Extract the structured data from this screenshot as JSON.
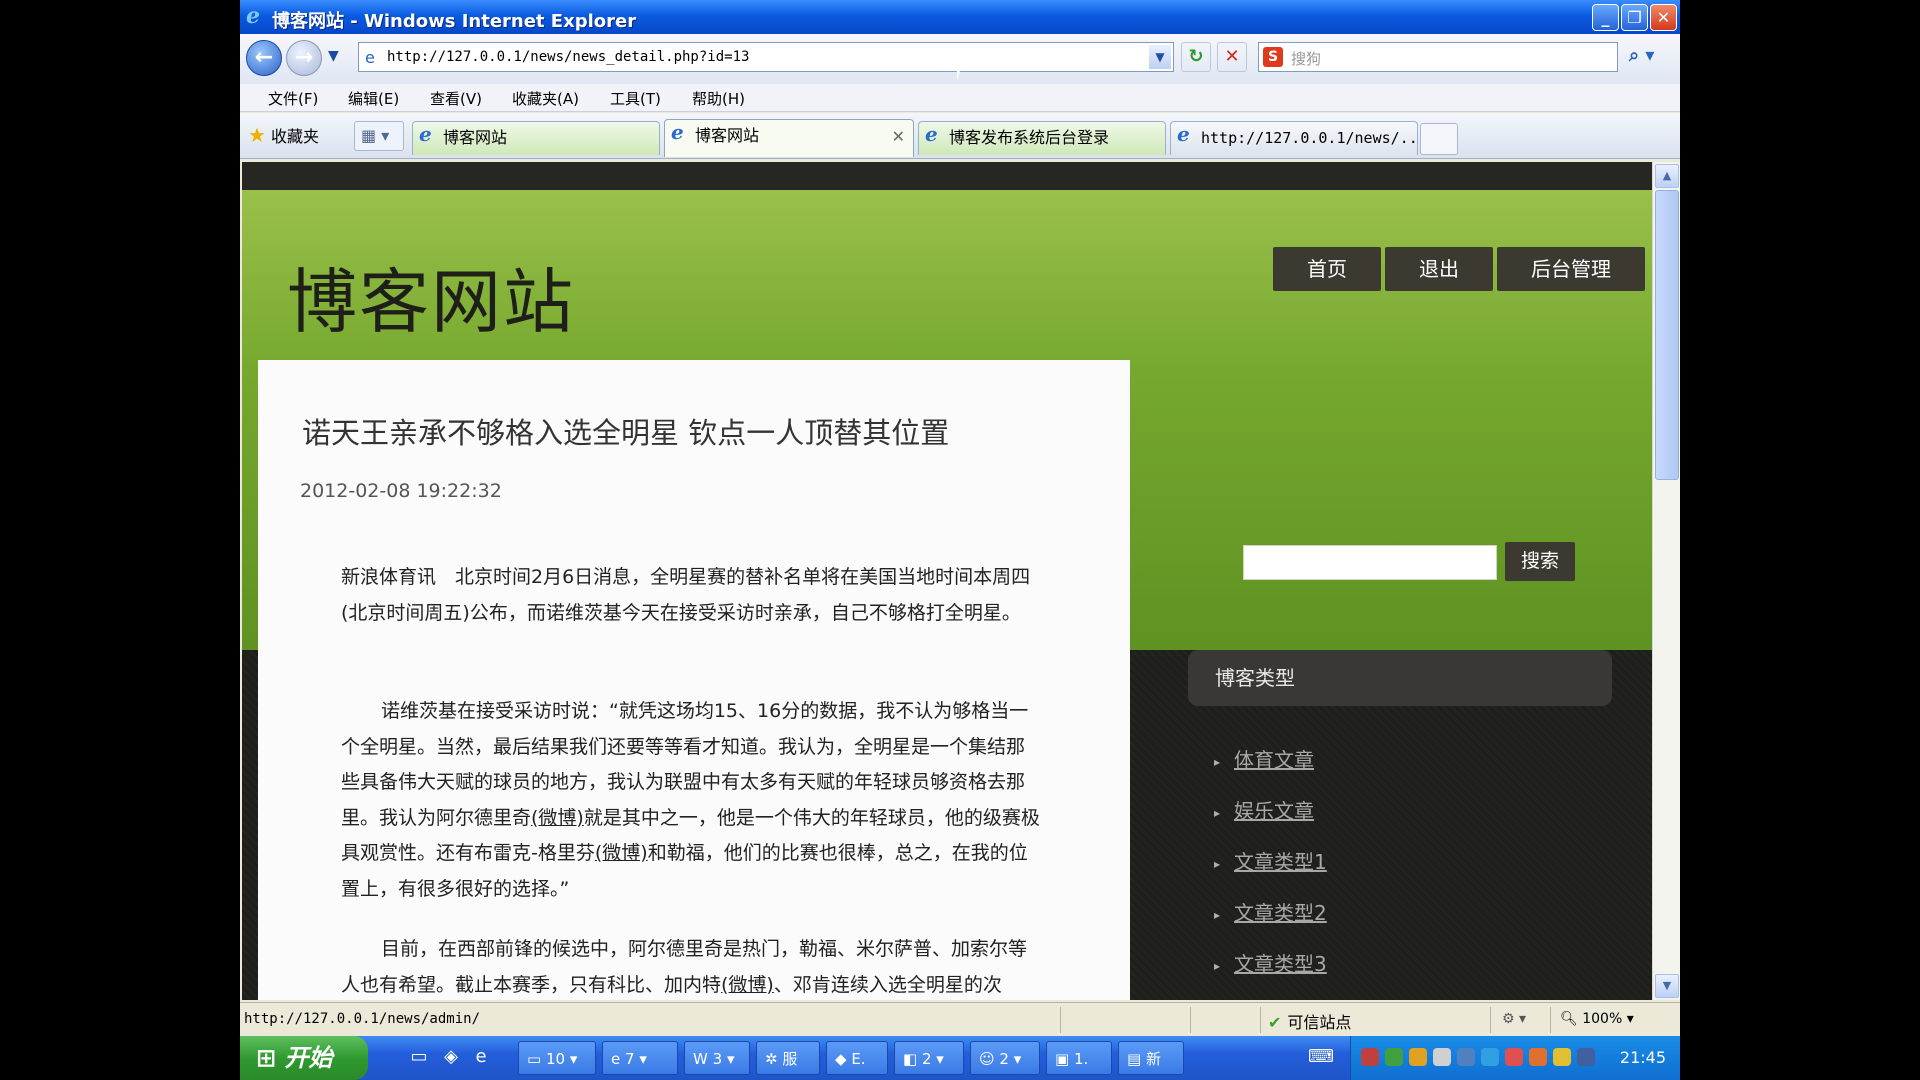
{
  "window": {
    "title": "博客网站 - Windows Internet Explorer",
    "min": "_",
    "max": "❐",
    "close": "✕"
  },
  "addressbar": {
    "url": "http://127.0.0.1/news/news_detail.php?id=13",
    "search_placeholder": "搜狗"
  },
  "menu": [
    "文件(F)",
    "编辑(E)",
    "查看(V)",
    "收藏夹(A)",
    "工具(T)",
    "帮助(H)"
  ],
  "favorites_label": "收藏夹",
  "tabs": [
    {
      "label": "博客网站"
    },
    {
      "label": "博客网站"
    },
    {
      "label": "博客发布系统后台登录"
    },
    {
      "label": "http://127.0.0.1/news/..."
    }
  ],
  "site": {
    "title": "博客网站",
    "nav": [
      "首页",
      "退出",
      "后台管理"
    ]
  },
  "article": {
    "title": "诺天王亲承不够格入选全明星 钦点一人顶替其位置",
    "date": "2012-02-08 19:22:32",
    "p1": "新浪体育讯　北京时间2月6日消息，全明星赛的替补名单将在美国当地时间本周四(北京时间周五)公布，而诺维茨基今天在接受采访时亲承，自己不够格打全明星。",
    "p2a": "诺维茨基在接受采访时说：“就凭这场均15、16分的数据，我不认为够格当一个全明星。当然，最后结果我们还要等等看才知道。我认为，全明星是一个集结那些具备伟大天赋的球员的地方，我认为联盟中有太多有天赋的年轻球员够资格去那里。我认为阿尔德里奇",
    "p2b": "就是其中之一，他是一个伟大的年轻球员，他的级赛极具观赏性。还有布雷克-格里芬",
    "p2c": "和勒福，他们的比赛也很棒，总之，在我的位置上，有很多很好的选择。”",
    "p3a": "目前，在西部前锋的候选中，阿尔德里奇是热门，勒福、米尔萨普、加索尔等人也有希望。截止本赛季，只有科比、加内特",
    "p3b": "、邓肯连续入选全明星的次",
    "weibo": "(微博)"
  },
  "sidebar": {
    "search_button": "搜索",
    "category_header": "博客类型",
    "categories": [
      "体育文章",
      "娱乐文章",
      "文章类型1",
      "文章类型2",
      "文章类型3"
    ]
  },
  "status": {
    "url": "http://127.0.0.1/news/admin/",
    "zone": "可信站点",
    "zoom": "100%"
  },
  "taskbar": {
    "start": "开始",
    "buttons": [
      "10",
      "7",
      "3",
      "服",
      "E.",
      "2",
      "2",
      "1.",
      "新"
    ],
    "clock": "21:45"
  }
}
